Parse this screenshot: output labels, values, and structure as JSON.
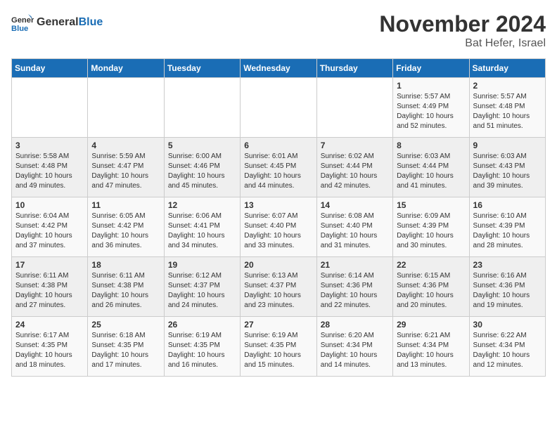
{
  "header": {
    "logo_line1": "General",
    "logo_line2": "Blue",
    "month": "November 2024",
    "location": "Bat Hefer, Israel"
  },
  "weekdays": [
    "Sunday",
    "Monday",
    "Tuesday",
    "Wednesday",
    "Thursday",
    "Friday",
    "Saturday"
  ],
  "weeks": [
    [
      {
        "day": "",
        "info": ""
      },
      {
        "day": "",
        "info": ""
      },
      {
        "day": "",
        "info": ""
      },
      {
        "day": "",
        "info": ""
      },
      {
        "day": "",
        "info": ""
      },
      {
        "day": "1",
        "info": "Sunrise: 5:57 AM\nSunset: 4:49 PM\nDaylight: 10 hours\nand 52 minutes."
      },
      {
        "day": "2",
        "info": "Sunrise: 5:57 AM\nSunset: 4:48 PM\nDaylight: 10 hours\nand 51 minutes."
      }
    ],
    [
      {
        "day": "3",
        "info": "Sunrise: 5:58 AM\nSunset: 4:48 PM\nDaylight: 10 hours\nand 49 minutes."
      },
      {
        "day": "4",
        "info": "Sunrise: 5:59 AM\nSunset: 4:47 PM\nDaylight: 10 hours\nand 47 minutes."
      },
      {
        "day": "5",
        "info": "Sunrise: 6:00 AM\nSunset: 4:46 PM\nDaylight: 10 hours\nand 45 minutes."
      },
      {
        "day": "6",
        "info": "Sunrise: 6:01 AM\nSunset: 4:45 PM\nDaylight: 10 hours\nand 44 minutes."
      },
      {
        "day": "7",
        "info": "Sunrise: 6:02 AM\nSunset: 4:44 PM\nDaylight: 10 hours\nand 42 minutes."
      },
      {
        "day": "8",
        "info": "Sunrise: 6:03 AM\nSunset: 4:44 PM\nDaylight: 10 hours\nand 41 minutes."
      },
      {
        "day": "9",
        "info": "Sunrise: 6:03 AM\nSunset: 4:43 PM\nDaylight: 10 hours\nand 39 minutes."
      }
    ],
    [
      {
        "day": "10",
        "info": "Sunrise: 6:04 AM\nSunset: 4:42 PM\nDaylight: 10 hours\nand 37 minutes."
      },
      {
        "day": "11",
        "info": "Sunrise: 6:05 AM\nSunset: 4:42 PM\nDaylight: 10 hours\nand 36 minutes."
      },
      {
        "day": "12",
        "info": "Sunrise: 6:06 AM\nSunset: 4:41 PM\nDaylight: 10 hours\nand 34 minutes."
      },
      {
        "day": "13",
        "info": "Sunrise: 6:07 AM\nSunset: 4:40 PM\nDaylight: 10 hours\nand 33 minutes."
      },
      {
        "day": "14",
        "info": "Sunrise: 6:08 AM\nSunset: 4:40 PM\nDaylight: 10 hours\nand 31 minutes."
      },
      {
        "day": "15",
        "info": "Sunrise: 6:09 AM\nSunset: 4:39 PM\nDaylight: 10 hours\nand 30 minutes."
      },
      {
        "day": "16",
        "info": "Sunrise: 6:10 AM\nSunset: 4:39 PM\nDaylight: 10 hours\nand 28 minutes."
      }
    ],
    [
      {
        "day": "17",
        "info": "Sunrise: 6:11 AM\nSunset: 4:38 PM\nDaylight: 10 hours\nand 27 minutes."
      },
      {
        "day": "18",
        "info": "Sunrise: 6:11 AM\nSunset: 4:38 PM\nDaylight: 10 hours\nand 26 minutes."
      },
      {
        "day": "19",
        "info": "Sunrise: 6:12 AM\nSunset: 4:37 PM\nDaylight: 10 hours\nand 24 minutes."
      },
      {
        "day": "20",
        "info": "Sunrise: 6:13 AM\nSunset: 4:37 PM\nDaylight: 10 hours\nand 23 minutes."
      },
      {
        "day": "21",
        "info": "Sunrise: 6:14 AM\nSunset: 4:36 PM\nDaylight: 10 hours\nand 22 minutes."
      },
      {
        "day": "22",
        "info": "Sunrise: 6:15 AM\nSunset: 4:36 PM\nDaylight: 10 hours\nand 20 minutes."
      },
      {
        "day": "23",
        "info": "Sunrise: 6:16 AM\nSunset: 4:36 PM\nDaylight: 10 hours\nand 19 minutes."
      }
    ],
    [
      {
        "day": "24",
        "info": "Sunrise: 6:17 AM\nSunset: 4:35 PM\nDaylight: 10 hours\nand 18 minutes."
      },
      {
        "day": "25",
        "info": "Sunrise: 6:18 AM\nSunset: 4:35 PM\nDaylight: 10 hours\nand 17 minutes."
      },
      {
        "day": "26",
        "info": "Sunrise: 6:19 AM\nSunset: 4:35 PM\nDaylight: 10 hours\nand 16 minutes."
      },
      {
        "day": "27",
        "info": "Sunrise: 6:19 AM\nSunset: 4:35 PM\nDaylight: 10 hours\nand 15 minutes."
      },
      {
        "day": "28",
        "info": "Sunrise: 6:20 AM\nSunset: 4:34 PM\nDaylight: 10 hours\nand 14 minutes."
      },
      {
        "day": "29",
        "info": "Sunrise: 6:21 AM\nSunset: 4:34 PM\nDaylight: 10 hours\nand 13 minutes."
      },
      {
        "day": "30",
        "info": "Sunrise: 6:22 AM\nSunset: 4:34 PM\nDaylight: 10 hours\nand 12 minutes."
      }
    ]
  ]
}
